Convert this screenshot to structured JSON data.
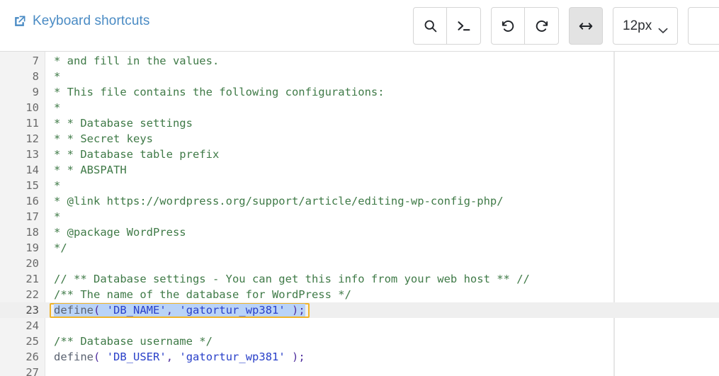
{
  "header": {
    "shortcuts_link": {
      "label": "Keyboard shortcuts",
      "icon": "external-link-icon",
      "color": "#4a8bc4"
    },
    "toolbar": {
      "search_button": {
        "label": "",
        "icon": "search-icon"
      },
      "console_button": {
        "label": "",
        "icon": "terminal-prompt-icon"
      },
      "undo_button": {
        "label": "",
        "icon": "undo-arrow-icon"
      },
      "redo_button": {
        "label": "",
        "icon": "redo-arrow-icon"
      },
      "wrap_button": {
        "label": "",
        "icon": "horizontal-arrows-icon",
        "active": true
      },
      "font_size_select": {
        "value": "12px",
        "icon": "chevron-down-icon"
      },
      "extra_button": {
        "label": ""
      }
    }
  },
  "editor": {
    "language": "php",
    "file_hint": "wp-config.php",
    "font_size": "12px",
    "selection": {
      "line": 23,
      "text": "define( 'DB_NAME', 'gatortur_wp381' );",
      "highlight_color": "#b9d3f7",
      "box_color": "#f0b429"
    },
    "lines": [
      {
        "num": "7",
        "tokens": [
          {
            "t": "cmt",
            "v": "* and fill in the values."
          }
        ]
      },
      {
        "num": "8",
        "tokens": [
          {
            "t": "cmt",
            "v": "*"
          }
        ]
      },
      {
        "num": "9",
        "tokens": [
          {
            "t": "cmt",
            "v": "* This file contains the following configurations:"
          }
        ]
      },
      {
        "num": "10",
        "tokens": [
          {
            "t": "cmt",
            "v": "*"
          }
        ]
      },
      {
        "num": "11",
        "tokens": [
          {
            "t": "cmt",
            "v": "* * Database settings"
          }
        ]
      },
      {
        "num": "12",
        "tokens": [
          {
            "t": "cmt",
            "v": "* * Secret keys"
          }
        ]
      },
      {
        "num": "13",
        "tokens": [
          {
            "t": "cmt",
            "v": "* * Database table prefix"
          }
        ]
      },
      {
        "num": "14",
        "tokens": [
          {
            "t": "cmt",
            "v": "* * ABSPATH"
          }
        ]
      },
      {
        "num": "15",
        "tokens": [
          {
            "t": "cmt",
            "v": "*"
          }
        ]
      },
      {
        "num": "16",
        "tokens": [
          {
            "t": "cmt",
            "v": "* @link https://wordpress.org/support/article/editing-wp-config-php/"
          }
        ]
      },
      {
        "num": "17",
        "tokens": [
          {
            "t": "cmt",
            "v": "*"
          }
        ]
      },
      {
        "num": "18",
        "tokens": [
          {
            "t": "cmt",
            "v": "* @package WordPress"
          }
        ]
      },
      {
        "num": "19",
        "tokens": [
          {
            "t": "cmt",
            "v": "*/"
          }
        ]
      },
      {
        "num": "20",
        "tokens": []
      },
      {
        "num": "21",
        "tokens": [
          {
            "t": "cmt",
            "v": "// ** Database settings - You can get this info from your web host ** //"
          }
        ]
      },
      {
        "num": "22",
        "tokens": [
          {
            "t": "cmt",
            "v": "/** The name of the database for WordPress */"
          }
        ]
      },
      {
        "num": "23",
        "highlighted": true,
        "selected": true,
        "tokens": [
          {
            "t": "fn",
            "v": "define"
          },
          {
            "t": "punc",
            "v": "("
          },
          {
            "t": "fn",
            "v": " "
          },
          {
            "t": "str",
            "v": "'DB_NAME'"
          },
          {
            "t": "punc",
            "v": ","
          },
          {
            "t": "fn",
            "v": " "
          },
          {
            "t": "str",
            "v": "'gatortur_wp381'"
          },
          {
            "t": "fn",
            "v": " "
          },
          {
            "t": "punc",
            "v": ")"
          },
          {
            "t": "punc",
            "v": ";"
          }
        ]
      },
      {
        "num": "24",
        "tokens": []
      },
      {
        "num": "25",
        "tokens": [
          {
            "t": "cmt",
            "v": "/** Database username */"
          }
        ]
      },
      {
        "num": "26",
        "tokens": [
          {
            "t": "fn",
            "v": "define"
          },
          {
            "t": "punc",
            "v": "("
          },
          {
            "t": "fn",
            "v": " "
          },
          {
            "t": "str",
            "v": "'DB_USER'"
          },
          {
            "t": "punc",
            "v": ","
          },
          {
            "t": "fn",
            "v": " "
          },
          {
            "t": "str",
            "v": "'gatortur_wp381'"
          },
          {
            "t": "fn",
            "v": " "
          },
          {
            "t": "punc",
            "v": ")"
          },
          {
            "t": "punc",
            "v": ";"
          }
        ]
      },
      {
        "num": "27",
        "tokens": []
      }
    ]
  }
}
